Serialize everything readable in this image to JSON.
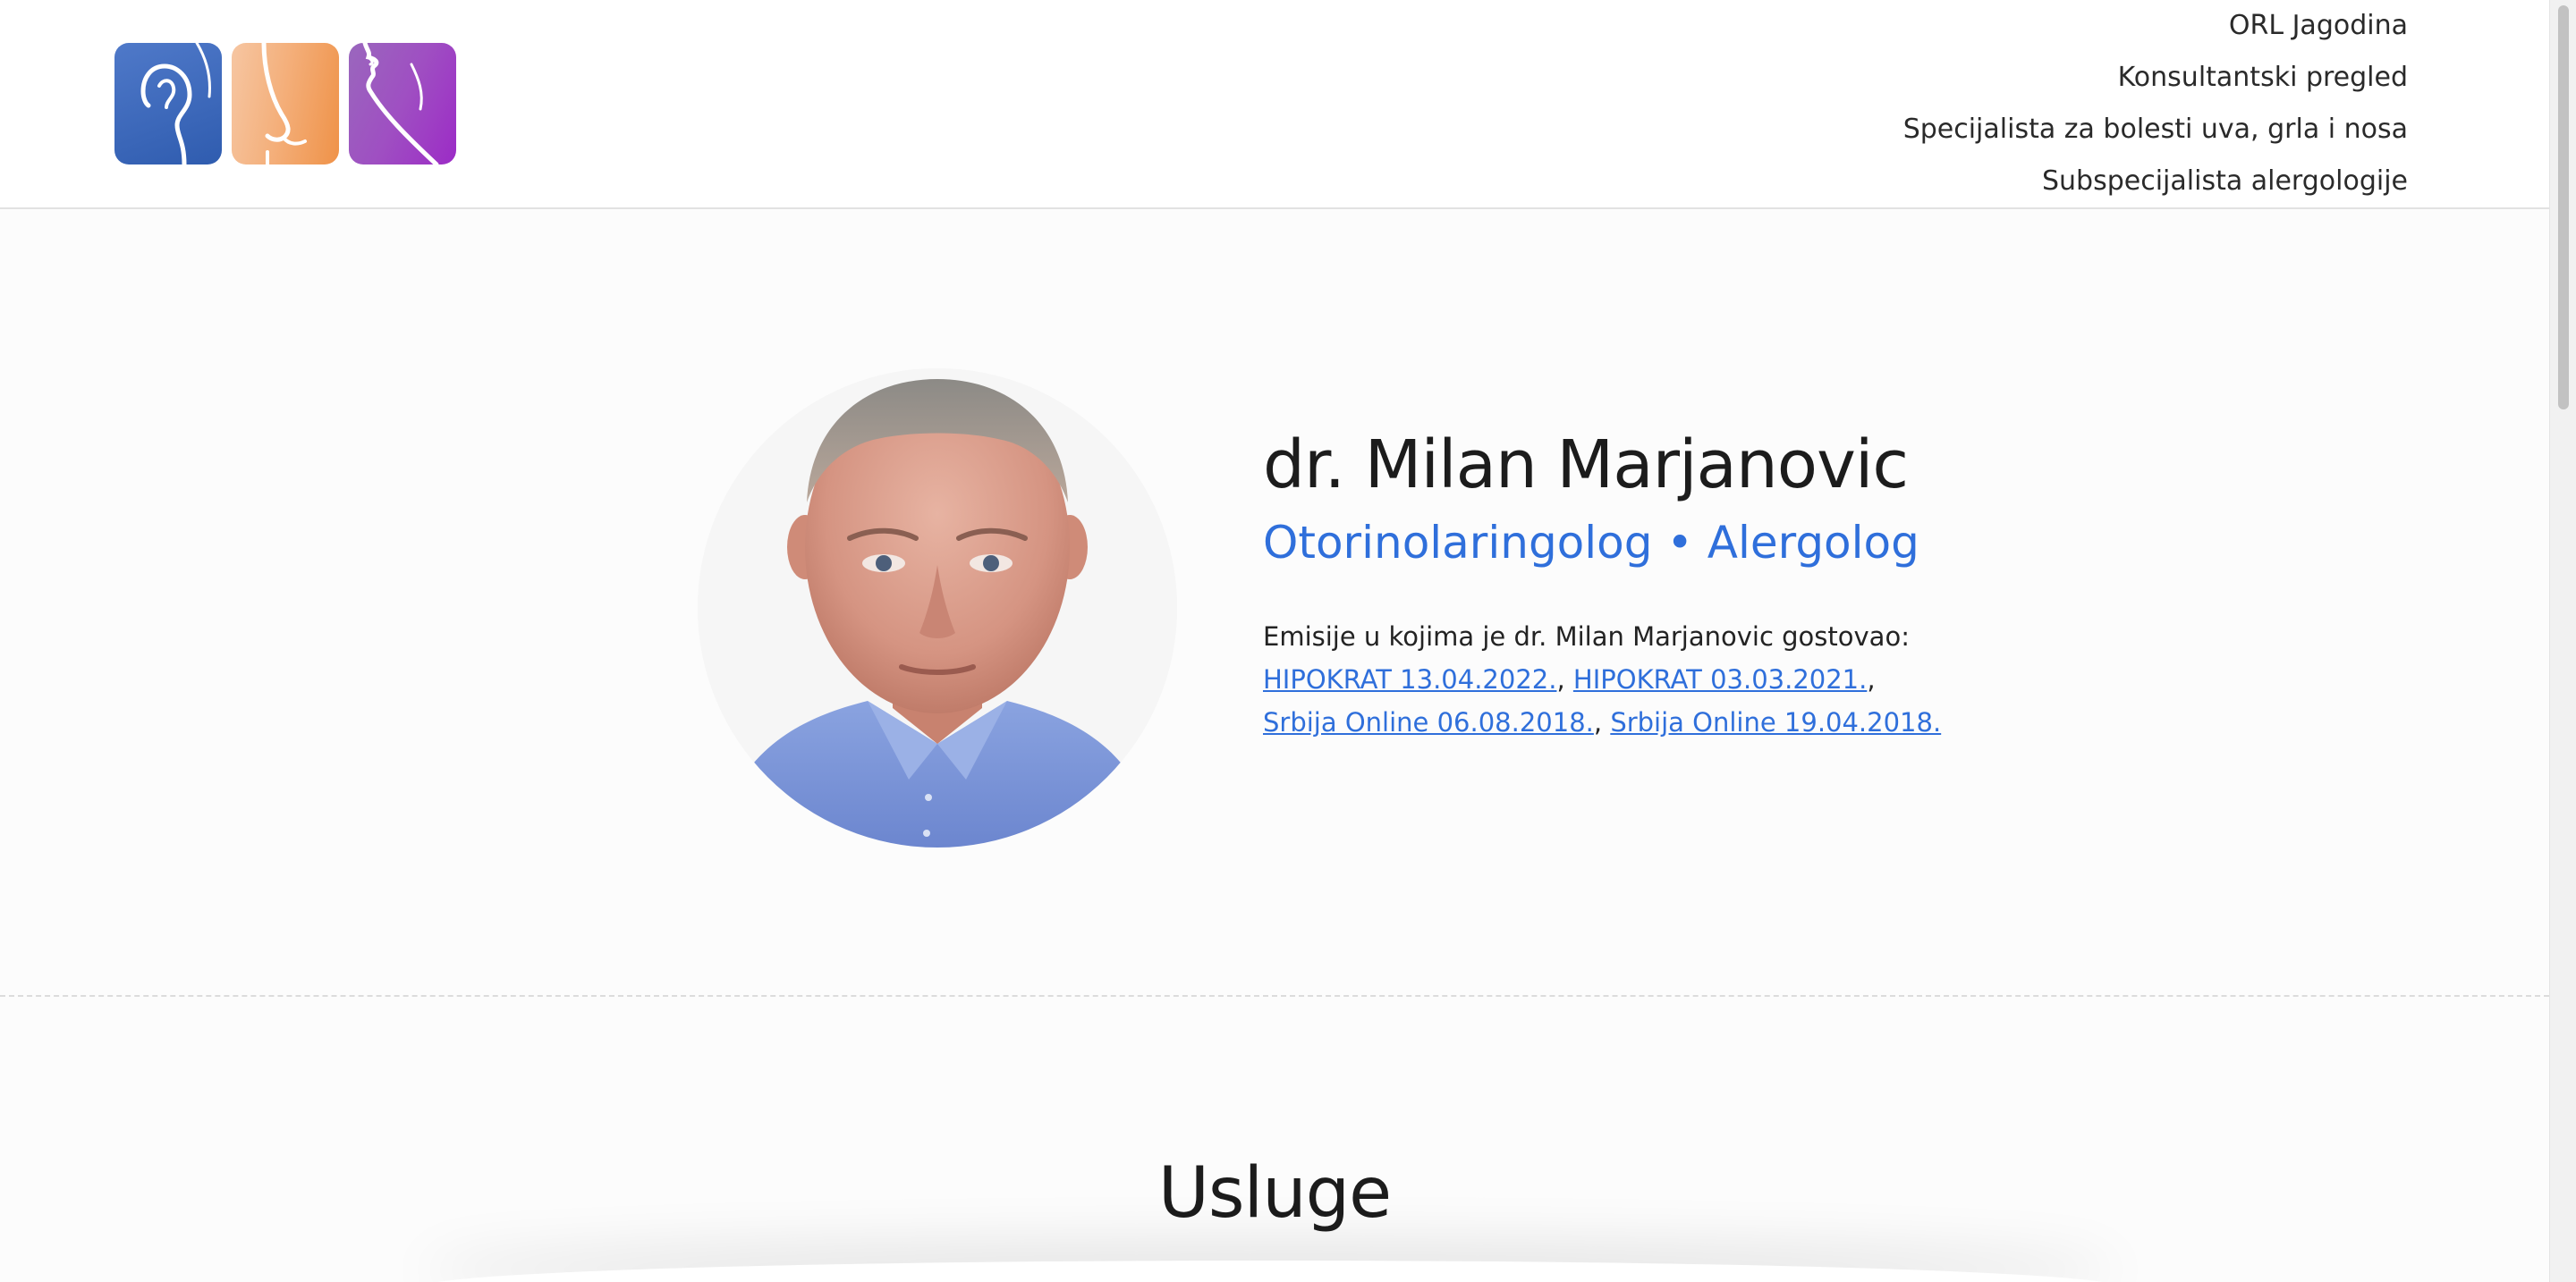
{
  "header": {
    "logo_alt": "ORL Jagodina logo",
    "nav": [
      "ORL Jagodina",
      "Konsultantski pregled",
      "Specijalista za bolesti uva, grla i nosa",
      "Subspecijalista alergologije"
    ]
  },
  "hero": {
    "name": "dr. Milan Marjanovic",
    "role": "Otorinolaringolog • Alergolog",
    "tv_intro": "Emisije u kojima je dr. Milan Marjanovic gostovao:",
    "tv_links": [
      "HIPOKRAT 13.04.2022.",
      "HIPOKRAT 03.03.2021.",
      "Srbija Online 06.08.2018.",
      "Srbija Online 19.04.2018."
    ]
  },
  "services": {
    "title": "Usluge"
  },
  "colors": {
    "accent": "#2f6fdb",
    "logo_ear": "#3a63b8",
    "logo_nose": "#f2a064",
    "logo_mouth": "#9b3fc4"
  },
  "icons": [
    "ear-icon",
    "nose-icon",
    "mouth-icon"
  ]
}
